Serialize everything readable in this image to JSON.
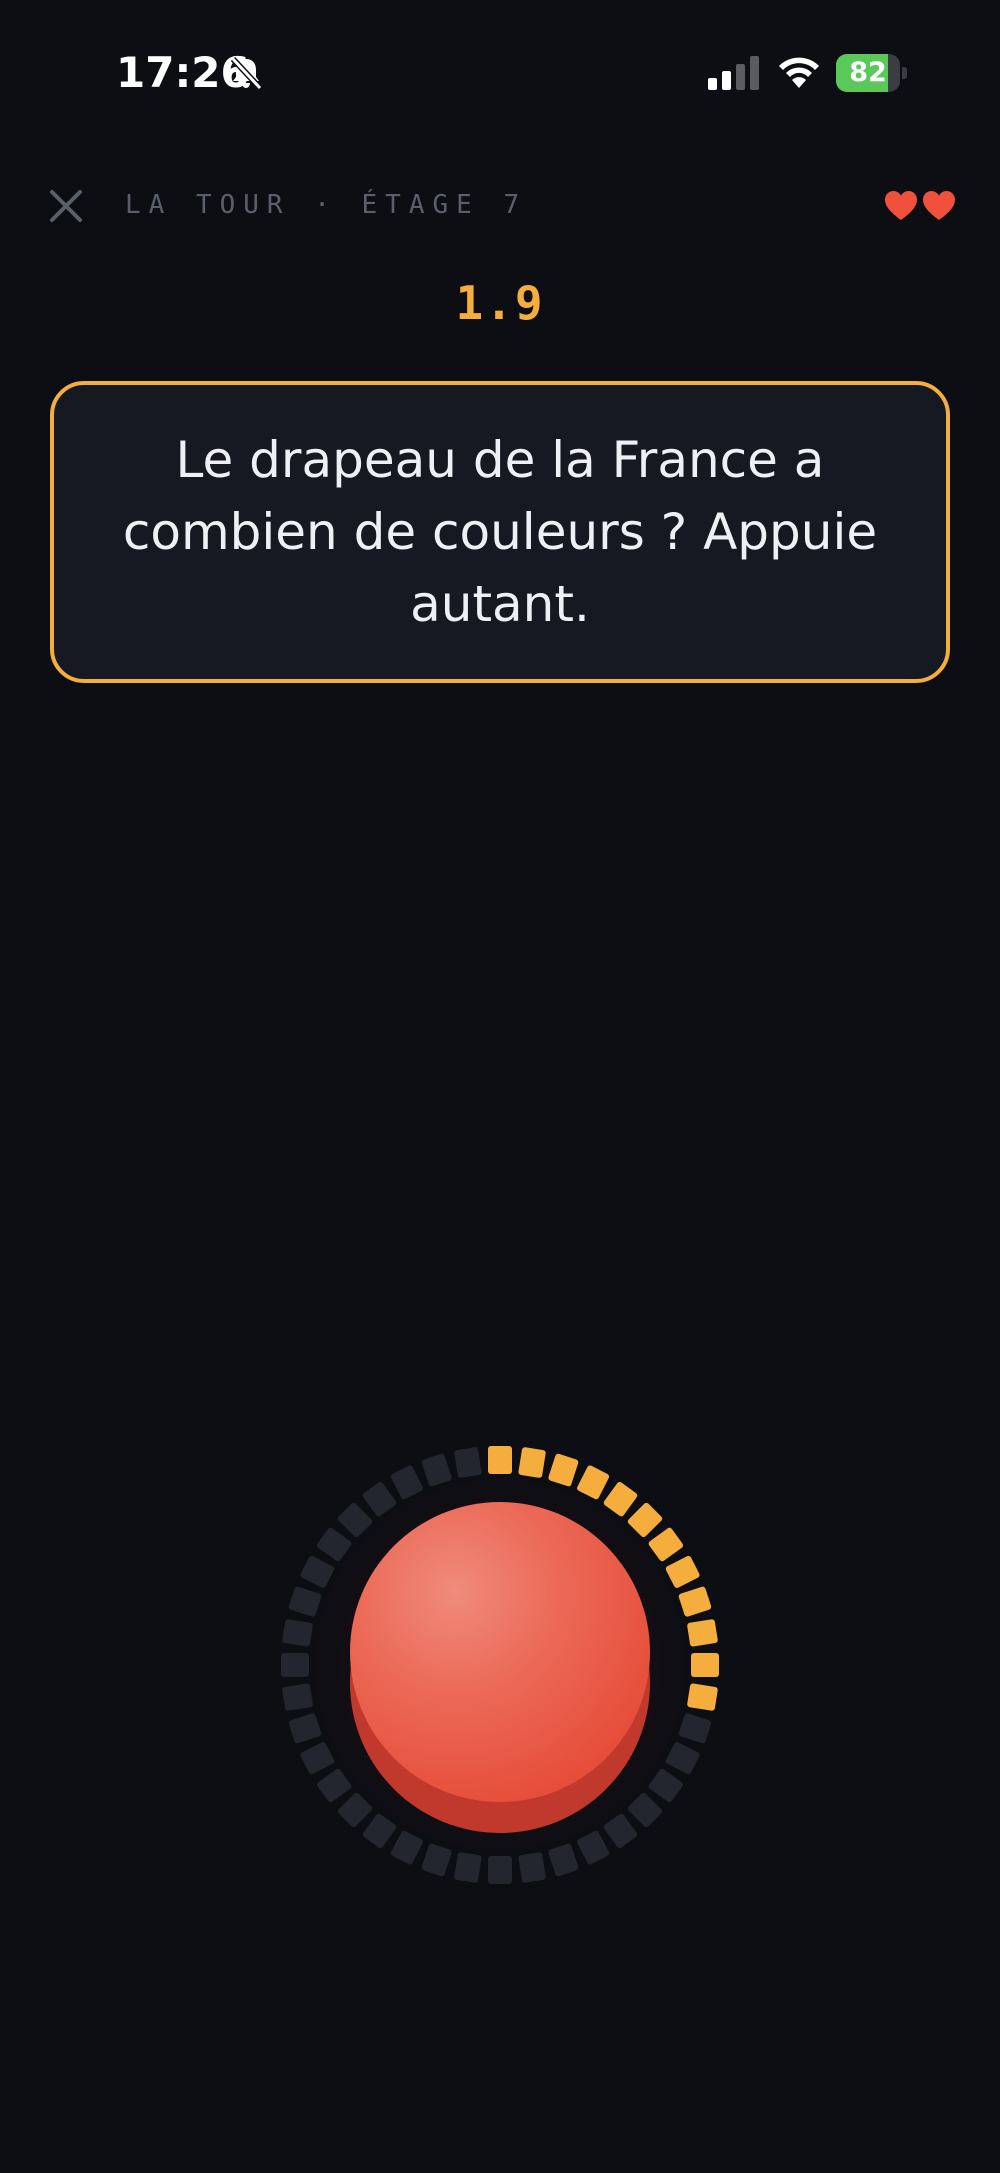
{
  "status_bar": {
    "time": "17:26",
    "battery_percent": 82,
    "battery_label": "82"
  },
  "header": {
    "title": "LA TOUR · ÉTAGE 7",
    "lives": 2
  },
  "timer": {
    "value": "1.9"
  },
  "question": {
    "text": "Le drapeau de la France a combien de couleurs ? Appuie autant."
  },
  "progress_ring": {
    "total_segments": 40,
    "filled_segments": 12
  },
  "colors": {
    "accent": "#f5ae3d",
    "heart": "#f0503c",
    "button": "#e64f3b",
    "background": "#0c0e14",
    "ring_inactive": "#23252f"
  },
  "icons": {
    "close": "close-icon",
    "heart": "heart-icon",
    "mute": "bell-slash-icon",
    "signal": "cellular-signal-icon",
    "wifi": "wifi-icon"
  }
}
